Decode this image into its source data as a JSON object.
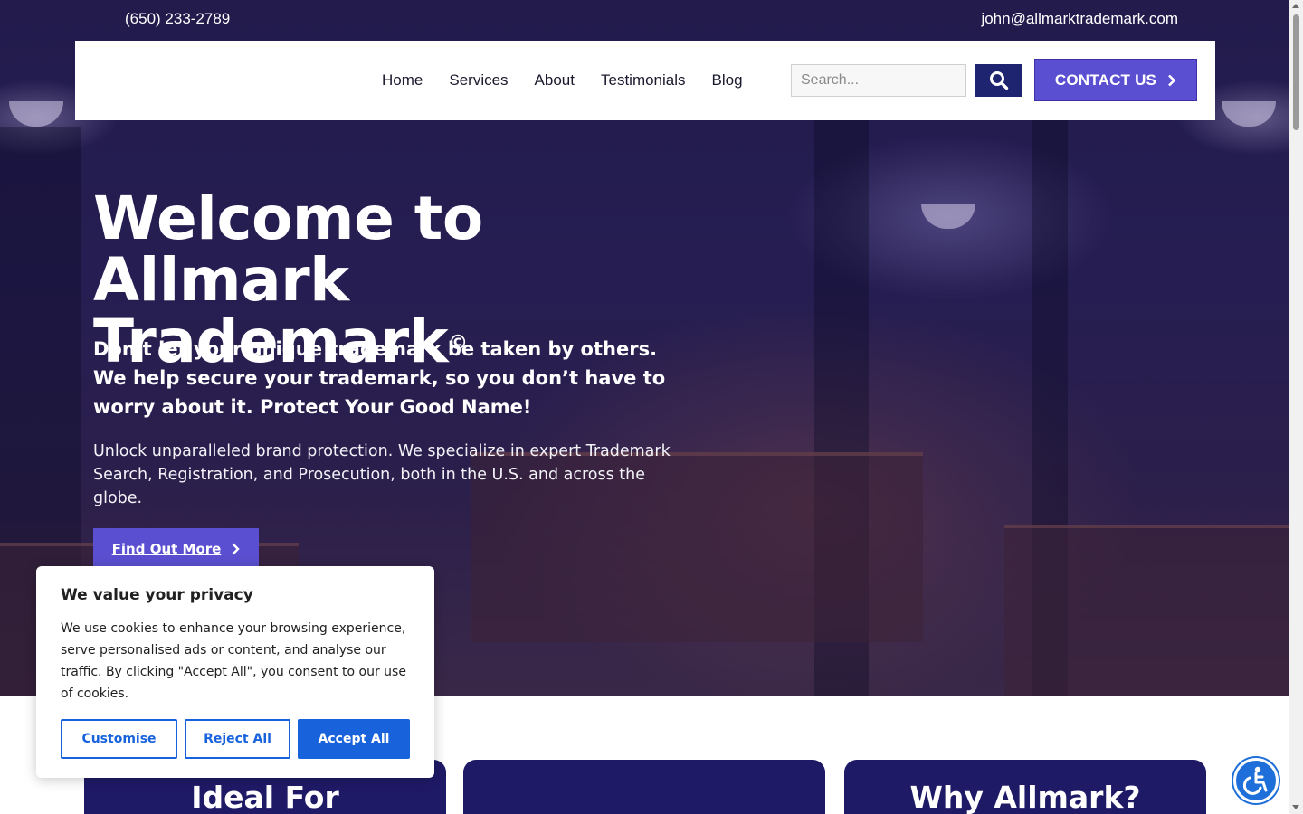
{
  "topbar": {
    "phone": "(650) 233-2789",
    "email": "john@allmarktrademark.com"
  },
  "nav": {
    "items": [
      {
        "label": "Home"
      },
      {
        "label": "Services"
      },
      {
        "label": "About"
      },
      {
        "label": "Testimonials"
      },
      {
        "label": "Blog"
      }
    ],
    "search_placeholder": "Search...",
    "search_icon": "search-icon",
    "contact_label": "CONTACT US"
  },
  "hero": {
    "title_line1": "Welcome to Allmark",
    "title_line2": "Trademark",
    "title_mark": "©",
    "subtitle": "Don’t let your unique trademark be taken by others.  We help secure your trademark, so you don’t have to worry about it. Protect Your Good Name!",
    "description": "Unlock unparalleled brand protection. We specialize in expert Trademark Search, Registration, and Prosecution, both in the U.S. and across the globe.",
    "cta_label": "Find Out More"
  },
  "cards": [
    {
      "title": "Ideal For"
    },
    {
      "title": ""
    },
    {
      "title": "Why Allmark?"
    }
  ],
  "cookie": {
    "title": "We value your privacy",
    "text": "We use cookies to enhance your browsing experience, serve personalised ads or content, and analyse our traffic. By clicking \"Accept All\", you consent to our use of cookies.",
    "customise_label": "Customise",
    "reject_label": "Reject All",
    "accept_label": "Accept All"
  },
  "colors": {
    "brand_purple": "#5b4fd1",
    "navy": "#1f2470",
    "cookie_blue": "#1863dc",
    "card_bg": "#1f1a66"
  }
}
